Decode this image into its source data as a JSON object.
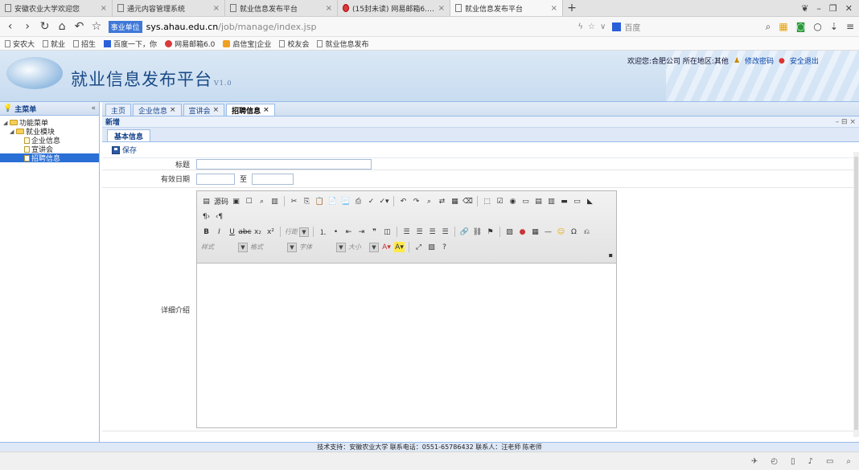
{
  "browser": {
    "tabs": [
      {
        "title": "安徽农业大学欢迎您"
      },
      {
        "title": "通元内容管理系统"
      },
      {
        "title": "就业信息发布平台"
      },
      {
        "title": "(15封未读) 网易邮箱6.0版"
      },
      {
        "title": "就业信息发布平台"
      }
    ],
    "url_badge": "事业单位",
    "url_host": "sys.ahau.edu.cn",
    "url_path": "/job/manage/index.jsp",
    "search_placeholder": "百度"
  },
  "bookmarks": [
    "安农大",
    "就业",
    "招生",
    "百度一下，你",
    "网易邮箱6.0",
    "启信宝|企业",
    "校友会",
    "就业信息发布"
  ],
  "header": {
    "title": "就业信息发布平台",
    "version": "V1.0",
    "welcome": "欢迎您:合肥公司 所在地区:其他",
    "change_password": "修改密码",
    "logout": "安全退出"
  },
  "sidebar": {
    "title": "主菜单",
    "collapse": "«",
    "tree": [
      {
        "label": "功能菜单",
        "level": 0
      },
      {
        "label": "就业模块",
        "level": 1
      },
      {
        "label": "企业信息",
        "level": 2
      },
      {
        "label": "宣讲会",
        "level": 2
      },
      {
        "label": "招聘信息",
        "level": 2,
        "selected": true
      }
    ]
  },
  "main": {
    "tabs": [
      {
        "label": "主页",
        "closable": false
      },
      {
        "label": "企业信息",
        "closable": true
      },
      {
        "label": "宣讲会",
        "closable": true
      },
      {
        "label": "招聘信息",
        "closable": true,
        "active": true
      }
    ],
    "panel_title": "新增",
    "panel_tools": "– ⊟ ×",
    "subtab": "基本信息",
    "save_label": "保存"
  },
  "form": {
    "title_label": "标题",
    "title_value": "",
    "date_label": "有效日期",
    "date_from": "",
    "date_separator": "至",
    "date_to": "",
    "detail_label": "详细介绍",
    "editor": {
      "source_label": "源码",
      "style_label": "样式",
      "format_label": "格式",
      "font_label": "字体",
      "size_label": "大小",
      "lineheight_label": "行距"
    }
  },
  "footer": {
    "text": "技术支持：安徽农业大学 联系电话：0551-65786432 联系人：汪老师 陈老师"
  }
}
